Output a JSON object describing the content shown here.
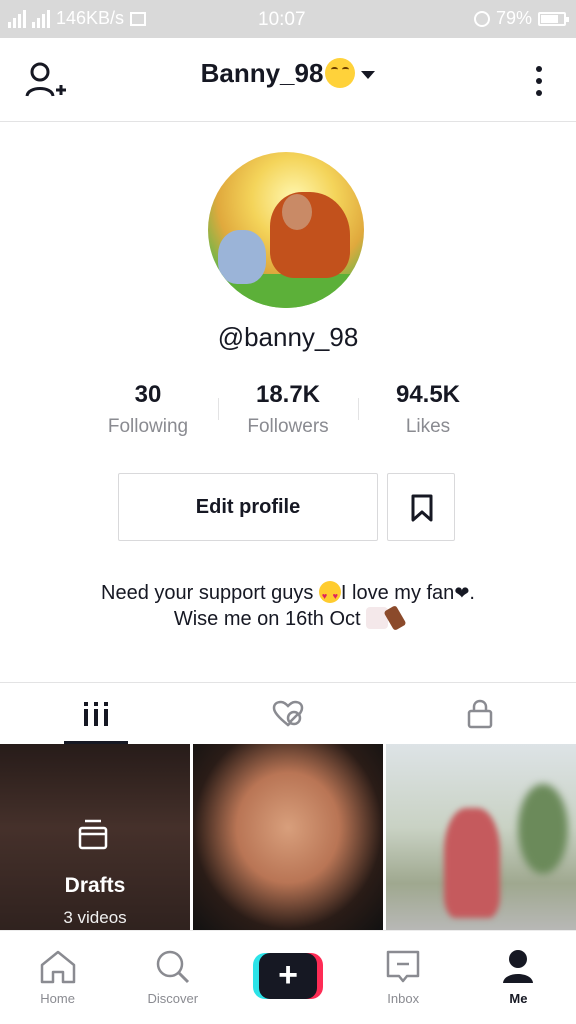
{
  "status_bar": {
    "network_speed": "146KB/s",
    "time": "10:07",
    "battery": "79%",
    "battery_level": 0.79
  },
  "header": {
    "username": "Banny_98"
  },
  "profile": {
    "handle": "@banny_98",
    "stats": [
      {
        "value": "30",
        "label": "Following"
      },
      {
        "value": "18.7K",
        "label": "Followers"
      },
      {
        "value": "94.5K",
        "label": "Likes"
      }
    ],
    "edit_button": "Edit profile",
    "bio_line1_a": "Need your support guys ",
    "bio_line1_b": "I love my fan",
    "bio_line1_c": ".",
    "bio_line2": "Wise me on 16th Oct "
  },
  "tabs": [
    {
      "icon": "grid-icon",
      "active": true
    },
    {
      "icon": "liked-heart-icon",
      "active": false
    },
    {
      "icon": "lock-icon",
      "active": false
    }
  ],
  "grid": {
    "drafts_title": "Drafts",
    "drafts_count": "3 videos"
  },
  "bottom_nav": {
    "items": [
      {
        "label": "Home",
        "icon": "home-icon"
      },
      {
        "label": "Discover",
        "icon": "search-icon"
      },
      {
        "label": "",
        "icon": "create-plus-icon"
      },
      {
        "label": "Inbox",
        "icon": "inbox-icon"
      },
      {
        "label": "Me",
        "icon": "profile-icon"
      }
    ],
    "create_symbol": "+"
  },
  "colors": {
    "text": "#161823",
    "muted": "#8a8b91",
    "accent_red": "#fe2c55",
    "accent_cyan": "#2ce3e8"
  }
}
